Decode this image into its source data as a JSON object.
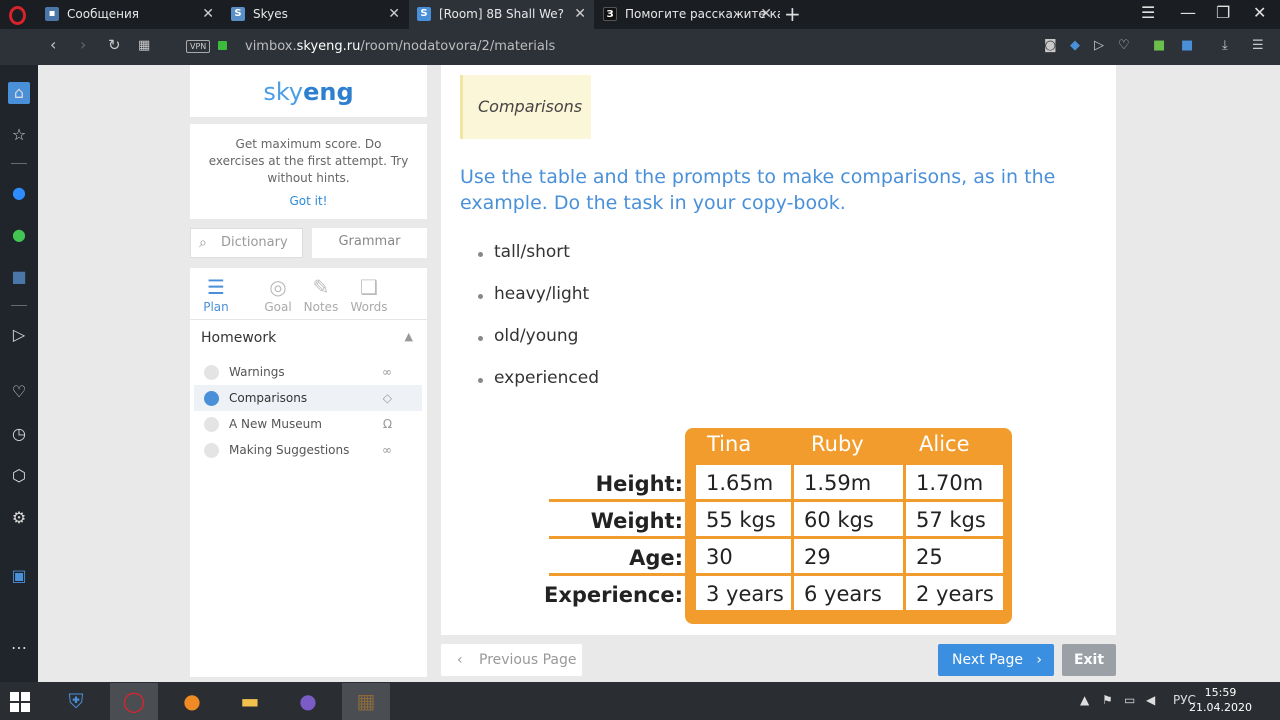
{
  "browser": {
    "tabs": [
      {
        "title": "Сообщения",
        "favicon": "chat-icon",
        "fav_color": "#4a76a8"
      },
      {
        "title": "Skyes",
        "favicon": "S",
        "fav_color": "#5b8fc7"
      },
      {
        "title": "[Room] 8B Shall We?",
        "favicon": "S",
        "fav_color": "#4a90d9"
      },
      {
        "title": "Помогите расскажите как",
        "favicon": "З",
        "fav_color": "#111111"
      }
    ],
    "vpn_label": "VPN",
    "url_prefix": "vimbox.",
    "url_domain": "skyeng.ru",
    "url_path": "/room/nodatovora/2/materials"
  },
  "left": {
    "logo_light": "sky",
    "logo_bold": "eng",
    "tip_text": "Get maximum score. Do exercises at the first attempt. Try without hints.",
    "tip_action": "Got it!",
    "search_placeholder": "Dictionary",
    "grammar_label": "Grammar",
    "nav_tabs": [
      {
        "label": "Plan",
        "icon": "plan-icon"
      },
      {
        "label": "Goal",
        "icon": "goal-icon"
      },
      {
        "label": "Notes",
        "icon": "notes-icon"
      },
      {
        "label": "Words",
        "icon": "words-icon"
      }
    ],
    "section_title": "Homework",
    "lessons": [
      {
        "title": "Warnings",
        "type_icon": "glasses-icon"
      },
      {
        "title": "Comparisons",
        "type_icon": "cap-icon"
      },
      {
        "title": "A New Museum",
        "type_icon": "headphones-icon"
      },
      {
        "title": "Making Suggestions",
        "type_icon": "glasses-icon"
      }
    ]
  },
  "main": {
    "subtitle": "Comparisons",
    "task": "Use the table and the prompts to make comparisons, as in the example. Do the task in your copy-book.",
    "prompts": [
      "tall/short",
      "heavy/light",
      "old/young",
      "experienced"
    ],
    "table": {
      "columns": [
        "Tina",
        "Ruby",
        "Alice"
      ],
      "rows": [
        {
          "label": "Height:",
          "values": [
            "1.65m",
            "1.59m",
            "1.70m"
          ]
        },
        {
          "label": "Weight:",
          "values": [
            "55 kgs",
            "60 kgs",
            "57 kgs"
          ]
        },
        {
          "label": "Age:",
          "values": [
            "30",
            "29",
            "25"
          ]
        },
        {
          "label": "Experience:",
          "values": [
            "3 years",
            "6 years",
            "2 years"
          ]
        }
      ],
      "accent_color": "#f39c2e"
    }
  },
  "footer": {
    "prev_label": "Previous Page",
    "next_label": "Next Page",
    "exit_label": "Exit"
  },
  "taskbar": {
    "lang": "РУС",
    "time": "15:59",
    "date": "21.04.2020"
  }
}
